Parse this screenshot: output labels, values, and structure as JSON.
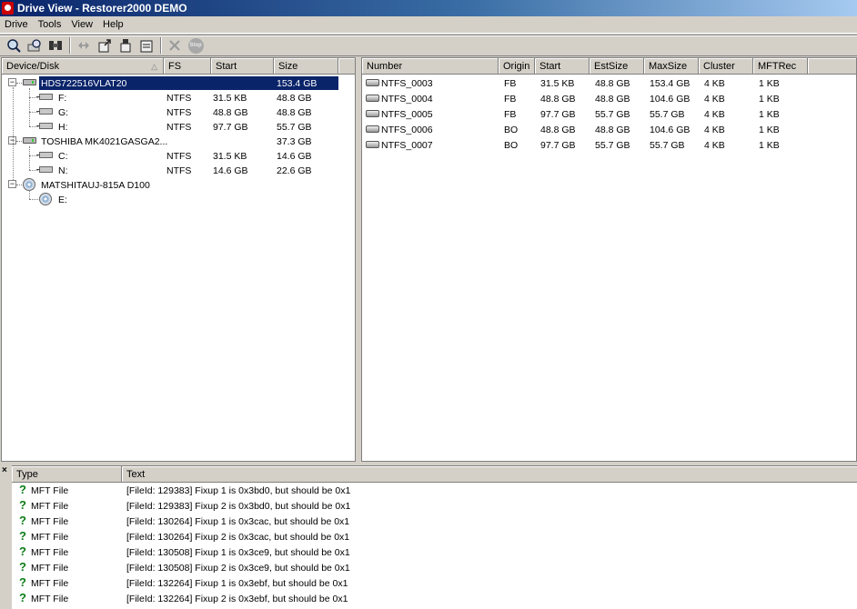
{
  "window": {
    "title": "Drive View - Restorer2000 DEMO"
  },
  "menu": [
    "Drive",
    "Tools",
    "View",
    "Help"
  ],
  "toolbar": {
    "buttons": [
      "open-drive-icon",
      "search-icon",
      "scan-icon",
      "navigate-icon",
      "export-icon",
      "save-icon",
      "properties-icon",
      "cancel-icon",
      "stop-icon"
    ],
    "stop_label": "Stop"
  },
  "left": {
    "headers": [
      "Device/Disk",
      "FS",
      "Start",
      "Size"
    ],
    "rows": [
      {
        "name": "HDS722516VLAT20",
        "fs": "",
        "start": "",
        "size": "153.4 GB",
        "level": 0,
        "type": "disk",
        "selected": true
      },
      {
        "name": "F:",
        "fs": "NTFS",
        "start": "31.5 KB",
        "size": "48.8 GB",
        "level": 1,
        "type": "partition"
      },
      {
        "name": "G:",
        "fs": "NTFS",
        "start": "48.8 GB",
        "size": "48.8 GB",
        "level": 1,
        "type": "partition"
      },
      {
        "name": "H:",
        "fs": "NTFS",
        "start": "97.7 GB",
        "size": "55.7 GB",
        "level": 1,
        "type": "partition"
      },
      {
        "name": "TOSHIBA MK4021GASGA2...",
        "fs": "",
        "start": "",
        "size": "37.3 GB",
        "level": 0,
        "type": "disk"
      },
      {
        "name": "C:",
        "fs": "NTFS",
        "start": "31.5 KB",
        "size": "14.6 GB",
        "level": 1,
        "type": "partition"
      },
      {
        "name": "N:",
        "fs": "NTFS",
        "start": "14.6 GB",
        "size": "22.6 GB",
        "level": 1,
        "type": "partition"
      },
      {
        "name": "MATSHITAUJ-815A D100",
        "fs": "",
        "start": "",
        "size": "",
        "level": 0,
        "type": "cdrom"
      },
      {
        "name": "E:",
        "fs": "",
        "start": "",
        "size": "",
        "level": 1,
        "type": "cdrom"
      }
    ]
  },
  "right": {
    "headers": [
      "Number",
      "Origin",
      "Start",
      "EstSize",
      "MaxSize",
      "Cluster",
      "MFTRec"
    ],
    "rows": [
      [
        "NTFS_0003",
        "FB",
        "31.5 KB",
        "48.8 GB",
        "153.4 GB",
        "4 KB",
        "1 KB"
      ],
      [
        "NTFS_0004",
        "FB",
        "48.8 GB",
        "48.8 GB",
        "104.6 GB",
        "4 KB",
        "1 KB"
      ],
      [
        "NTFS_0005",
        "FB",
        "97.7 GB",
        "55.7 GB",
        "55.7 GB",
        "4 KB",
        "1 KB"
      ],
      [
        "NTFS_0006",
        "BO",
        "48.8 GB",
        "48.8 GB",
        "104.6 GB",
        "4 KB",
        "1 KB"
      ],
      [
        "NTFS_0007",
        "BO",
        "97.7 GB",
        "55.7 GB",
        "55.7 GB",
        "4 KB",
        "1 KB"
      ]
    ]
  },
  "log": {
    "close_glyph": "×",
    "headers": [
      "Type",
      "Text"
    ],
    "rows": [
      [
        "MFT File",
        "[FileId: 129383] Fixup 1 is 0x3bd0, but should be 0x1"
      ],
      [
        "MFT File",
        "[FileId: 129383] Fixup 2 is 0x3bd0, but should be 0x1"
      ],
      [
        "MFT File",
        "[FileId: 130264] Fixup 1 is 0x3cac, but should be 0x1"
      ],
      [
        "MFT File",
        "[FileId: 130264] Fixup 2 is 0x3cac, but should be 0x1"
      ],
      [
        "MFT File",
        "[FileId: 130508] Fixup 1 is 0x3ce9, but should be 0x1"
      ],
      [
        "MFT File",
        "[FileId: 130508] Fixup 2 is 0x3ce9, but should be 0x1"
      ],
      [
        "MFT File",
        "[FileId: 132264] Fixup 1 is 0x3ebf, but should be 0x1"
      ],
      [
        "MFT File",
        "[FileId: 132264] Fixup 2 is 0x3ebf, but should be 0x1"
      ]
    ]
  },
  "colors": {
    "selection": "#0a246a",
    "title_start": "#0a246a",
    "title_end": "#a6caf0",
    "warning_icon": "#0a7d16"
  }
}
